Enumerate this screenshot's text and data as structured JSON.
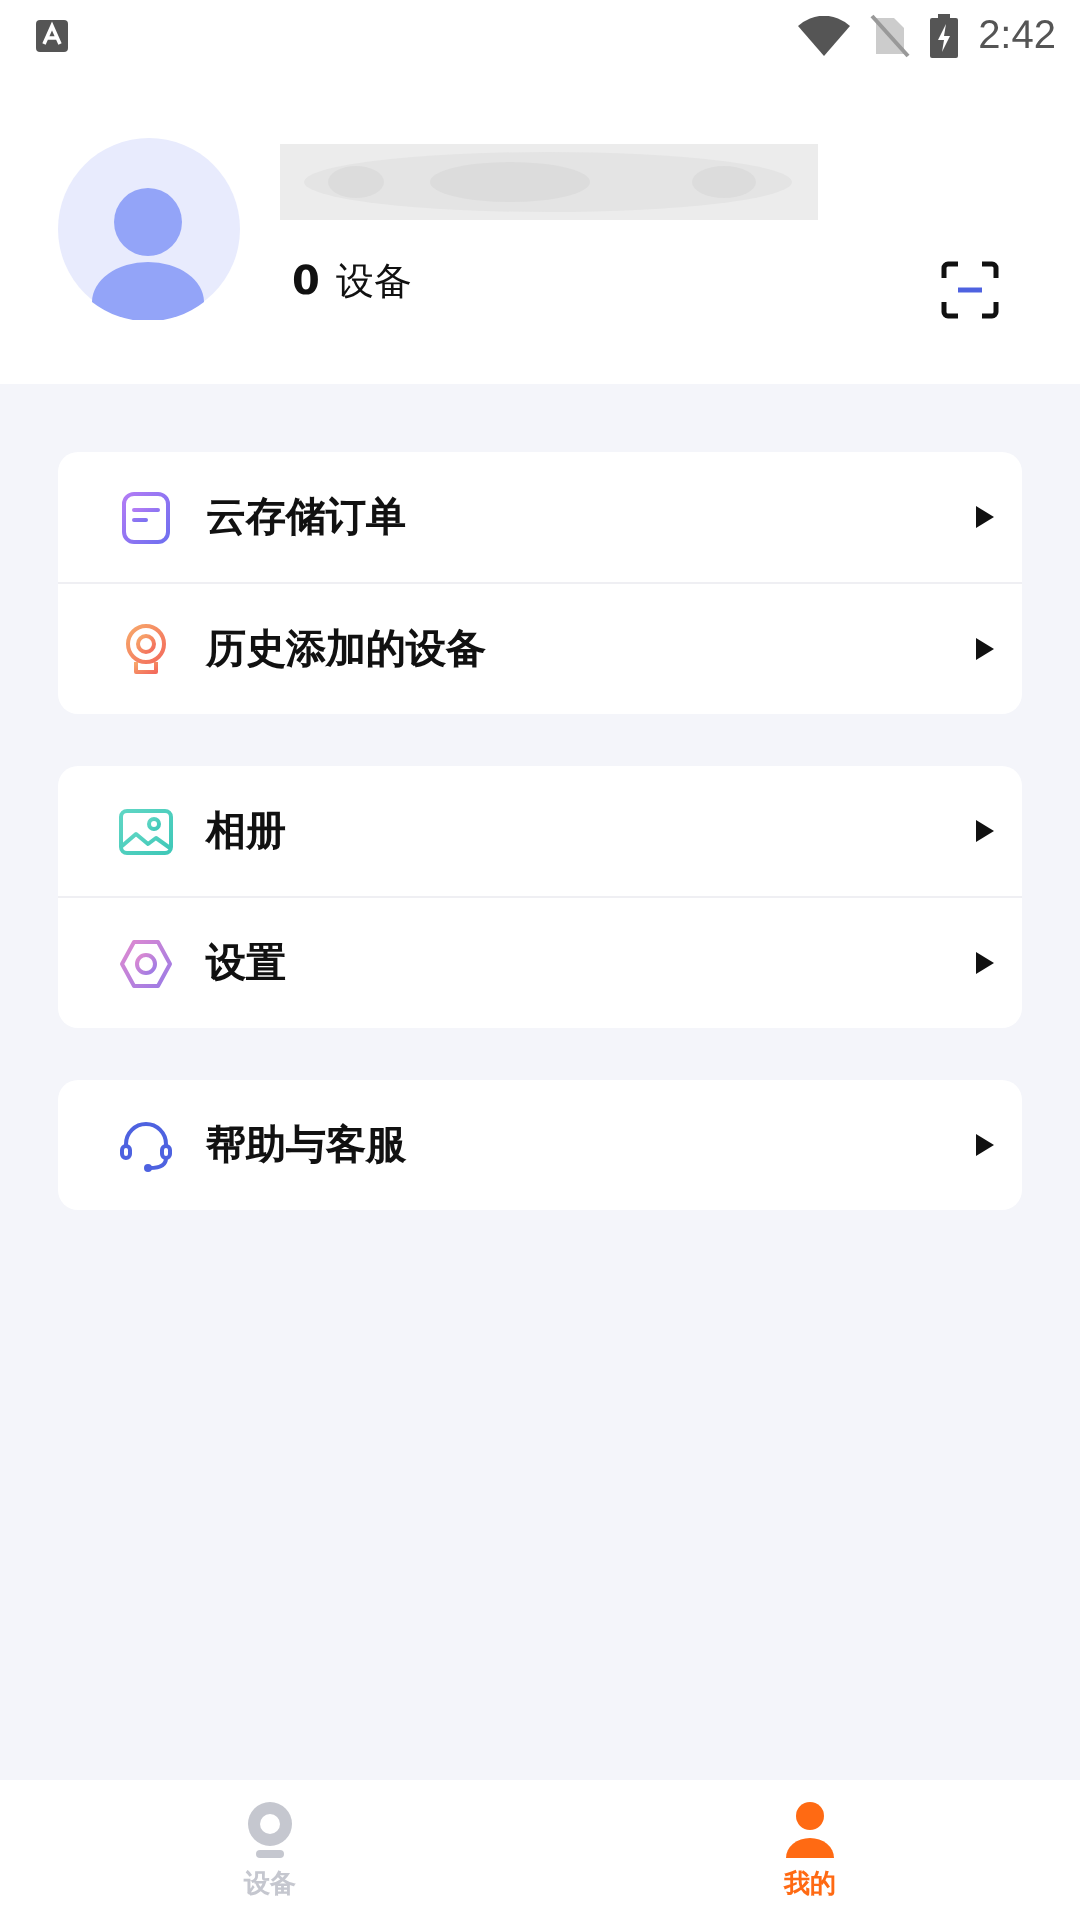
{
  "status_bar": {
    "time": "2:42"
  },
  "profile": {
    "device_count": "0",
    "device_label": "设备"
  },
  "menu_groups": [
    {
      "items": [
        {
          "kind": "orders",
          "label": "云存储订单"
        },
        {
          "kind": "history",
          "label": "历史添加的设备"
        }
      ]
    },
    {
      "items": [
        {
          "kind": "album",
          "label": "相册"
        },
        {
          "kind": "settings",
          "label": "设置"
        }
      ]
    },
    {
      "items": [
        {
          "kind": "support",
          "label": "帮助与客服"
        }
      ]
    }
  ],
  "tab_bar": [
    {
      "kind": "devices",
      "label": "设备",
      "selected": false
    },
    {
      "kind": "me",
      "label": "我的",
      "selected": true
    }
  ]
}
